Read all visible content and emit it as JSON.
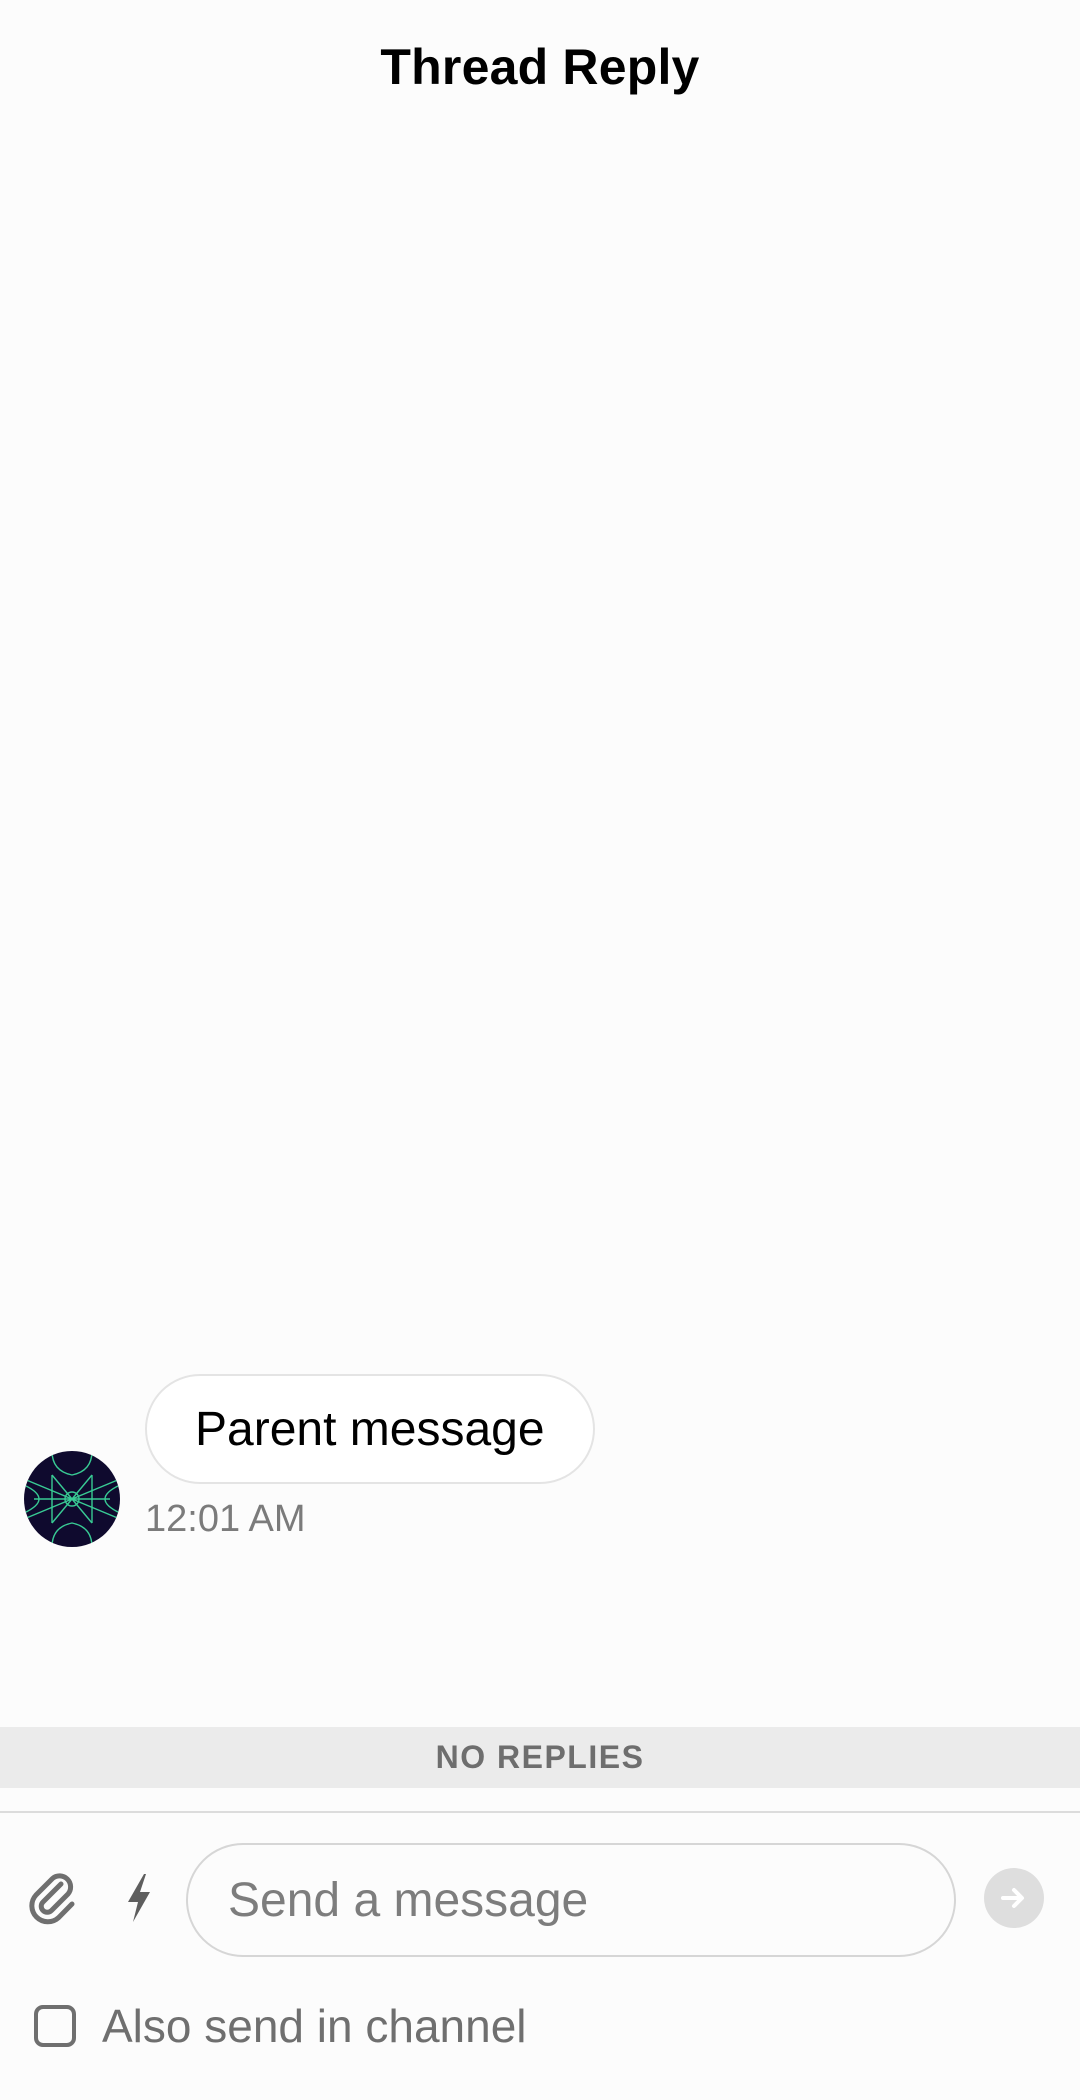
{
  "header": {
    "title": "Thread Reply"
  },
  "parent_message": {
    "text": "Parent message",
    "time": "12:01 AM",
    "avatar_icon": "geometric-pattern-avatar"
  },
  "replies": {
    "status": "NO REPLIES"
  },
  "composer": {
    "attach_icon": "paperclip-icon",
    "commands_icon": "lightning-bolt-icon",
    "placeholder": "Send a message",
    "value": "",
    "send_icon": "arrow-right-icon",
    "also_send_label": "Also send in channel",
    "also_send_checked": false
  },
  "colors": {
    "background": "#fcfcfc",
    "replies_bar": "#ebebeb",
    "muted_text": "#7b7b7b",
    "avatar_bg": "#0f0a2e",
    "avatar_lines": "#3ee0a0",
    "send_button_disabled": "#dedede"
  }
}
